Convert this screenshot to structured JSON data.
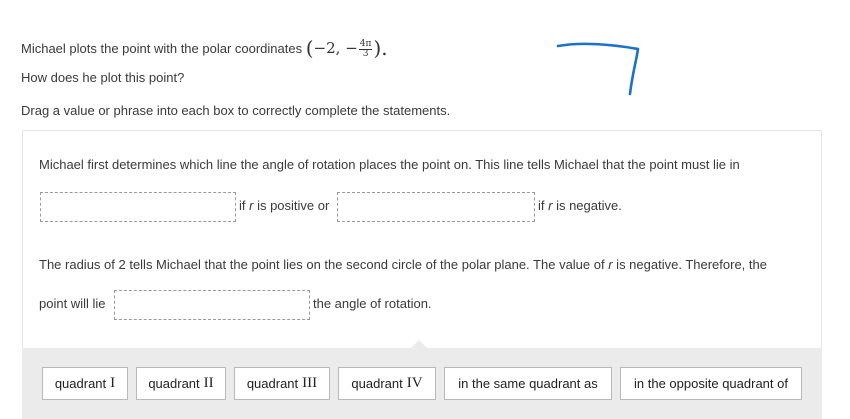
{
  "question": {
    "intro_prefix": "Michael plots the point with the polar coordinates",
    "coord_r": "−2,",
    "coord_minus": "−",
    "coord_frac_num": "4π",
    "coord_frac_den": "3",
    "coord_close": ").",
    "coord_open": "(",
    "line2": "How does he plot this point?",
    "line3": "Drag a value or phrase into each box to correctly complete the statements."
  },
  "panel": {
    "sentence1": "Michael first determines which line the angle of rotation places the point on. This line tells Michael that the point must lie in",
    "s2_if": "if ",
    "s2_r1": "r",
    "s2_pos": " is positive or",
    "s2_if2": "if ",
    "s2_r2": "r",
    "s2_neg": " is negative.",
    "sentence3_a": "The radius of 2 tells Michael that the point lies on the second circle of the polar plane. The value of ",
    "sentence3_r": "r",
    "sentence3_b": " is negative. Therefore, the",
    "s4_prefix": "point will lie",
    "s4_suffix": "the angle of rotation."
  },
  "choices": [
    {
      "text": "quadrant",
      "roman": "I"
    },
    {
      "text": "quadrant",
      "roman": "II"
    },
    {
      "text": "quadrant",
      "roman": "III"
    },
    {
      "text": "quadrant",
      "roman": "IV"
    },
    {
      "text": "in the same quadrant as",
      "roman": ""
    },
    {
      "text": "in the opposite quadrant of",
      "roman": ""
    }
  ],
  "colors": {
    "scribble": "#1a73c9",
    "tray": "#ebebeb",
    "dashed": "#9a9a9a"
  }
}
